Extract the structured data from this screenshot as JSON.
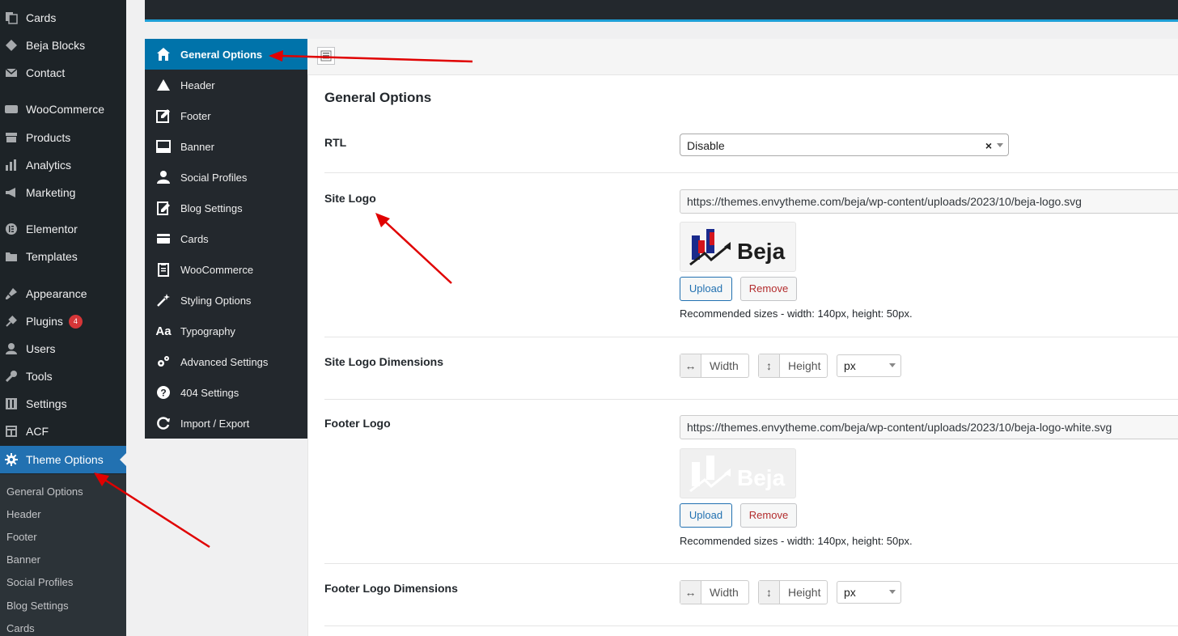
{
  "wp_sidebar": {
    "items": [
      {
        "label": "Cards",
        "icon": "cards-icon"
      },
      {
        "label": "Beja Blocks",
        "icon": "blocks-icon"
      },
      {
        "label": "Contact",
        "icon": "mail-icon"
      },
      {
        "label": "WooCommerce",
        "icon": "woo-icon"
      },
      {
        "label": "Products",
        "icon": "products-icon"
      },
      {
        "label": "Analytics",
        "icon": "analytics-icon"
      },
      {
        "label": "Marketing",
        "icon": "megaphone-icon"
      },
      {
        "label": "Elementor",
        "icon": "elementor-icon"
      },
      {
        "label": "Templates",
        "icon": "folder-icon"
      },
      {
        "label": "Appearance",
        "icon": "brush-icon"
      },
      {
        "label": "Plugins",
        "icon": "plug-icon",
        "badge": "4"
      },
      {
        "label": "Users",
        "icon": "user-icon"
      },
      {
        "label": "Tools",
        "icon": "wrench-icon"
      },
      {
        "label": "Settings",
        "icon": "settings-icon"
      },
      {
        "label": "ACF",
        "icon": "acf-icon"
      },
      {
        "label": "Theme Options",
        "icon": "gear-icon",
        "active": true
      }
    ],
    "submenu": [
      "General Options",
      "Header",
      "Footer",
      "Banner",
      "Social Profiles",
      "Blog Settings",
      "Cards"
    ]
  },
  "options_nav": {
    "items": [
      {
        "label": "General Options",
        "icon": "home-icon",
        "active": true
      },
      {
        "label": "Header",
        "icon": "triangle-icon"
      },
      {
        "label": "Footer",
        "icon": "edit-icon"
      },
      {
        "label": "Banner",
        "icon": "banner-icon"
      },
      {
        "label": "Social Profiles",
        "icon": "person-icon"
      },
      {
        "label": "Blog Settings",
        "icon": "pencil-doc-icon"
      },
      {
        "label": "Cards",
        "icon": "card-icon"
      },
      {
        "label": "WooCommerce",
        "icon": "clipboard-icon"
      },
      {
        "label": "Styling Options",
        "icon": "magic-wand-icon"
      },
      {
        "label": "Typography",
        "icon": "typography-icon"
      },
      {
        "label": "Advanced Settings",
        "icon": "cogs-icon"
      },
      {
        "label": "404 Settings",
        "icon": "question-icon"
      },
      {
        "label": "Import / Export",
        "icon": "refresh-icon"
      }
    ]
  },
  "main": {
    "title": "General Options",
    "rtl": {
      "label": "RTL",
      "value": "Disable",
      "clear": "×"
    },
    "site_logo": {
      "label": "Site Logo",
      "url": "https://themes.envytheme.com/beja/wp-content/uploads/2023/10/beja-logo.svg",
      "logo_text": "Beja",
      "upload": "Upload",
      "remove": "Remove",
      "hint": "Recommended sizes - width: 140px, height: 50px."
    },
    "site_logo_dims": {
      "label": "Site Logo Dimensions",
      "width": "Width",
      "height": "Height",
      "unit": "px"
    },
    "footer_logo": {
      "label": "Footer Logo",
      "url": "https://themes.envytheme.com/beja/wp-content/uploads/2023/10/beja-logo-white.svg",
      "logo_text": "Beja",
      "upload": "Upload",
      "remove": "Remove",
      "hint": "Recommended sizes - width: 140px, height: 50px."
    },
    "footer_logo_dims": {
      "label": "Footer Logo Dimensions",
      "width": "Width",
      "height": "Height",
      "unit": "px"
    }
  },
  "colors": {
    "wp_active": "#2271b1",
    "options_active": "#0073aa",
    "annotation_arrow": "#e00000",
    "logo_blue": "#1a2a8c",
    "logo_red": "#d4151d"
  }
}
